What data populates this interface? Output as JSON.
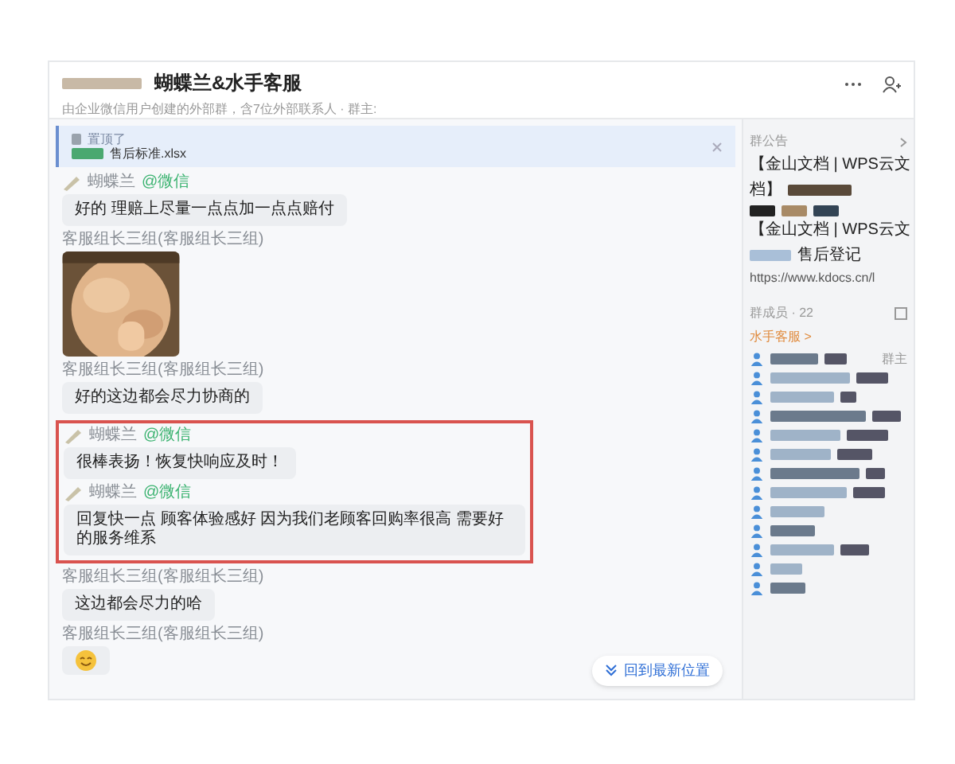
{
  "chat": {
    "title": "蝴蝶兰&水手客服",
    "subtitle": "由企业微信用户创建的外部群，含7位外部联系人 · 群主:"
  },
  "pinned": {
    "action": "置顶了",
    "file": "售后标准.xlsx"
  },
  "messages": [
    {
      "sender": "蝴蝶兰",
      "tag": "@微信",
      "kind": "text",
      "text": "好的 理赔上尽量一点点加一点点赔付",
      "highlighted": false
    },
    {
      "sender": "客服组长三组(客服组长三组)",
      "highlighted": false
    },
    {
      "sender": "客服组长三组(客服组长三组)",
      "kind": "text",
      "text": "好的这边都会尽力协商的",
      "highlighted": false
    },
    {
      "sender": "蝴蝶兰",
      "tag": "@微信",
      "kind": "text",
      "text": "很棒表扬！恢复快响应及时！",
      "highlighted": true
    },
    {
      "sender": "蝴蝶兰",
      "tag": "@微信",
      "kind": "text",
      "text": "回复快一点 顾客体验感好 因为我们老顾客回购率很高 需要好的服务维系",
      "highlighted": true
    },
    {
      "sender": "客服组长三组(客服组长三组)",
      "kind": "text",
      "text": "这边都会尽力的哈",
      "highlighted": false
    },
    {
      "sender": "客服组长三组(客服组长三组)",
      "kind": "emoji",
      "highlighted": false
    }
  ],
  "jump_button": "回到最新位置",
  "sidebar": {
    "announcement_title": "群公告",
    "announcement_lines": [
      "【金山文档 | WPS云文",
      "档】",
      "【金山文档 | WPS云文",
      "售后登记",
      "https://www.kdocs.cn/l"
    ],
    "members_title": "群成员 · 22",
    "members_group": "水手客服 >",
    "owner_badge": "群主"
  }
}
